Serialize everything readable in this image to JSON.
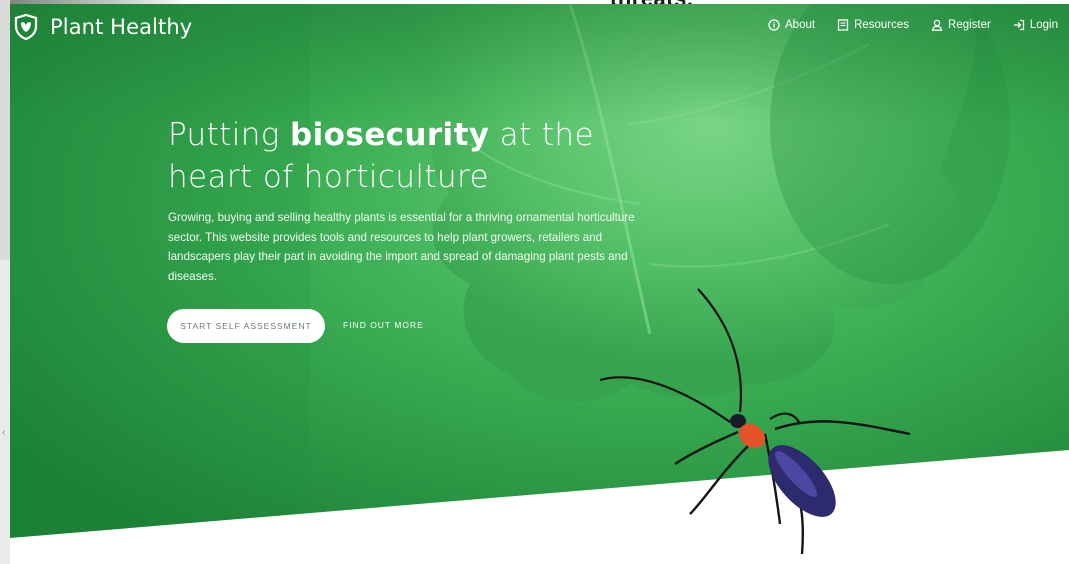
{
  "background_leak": {
    "top_text": "threats."
  },
  "brand": {
    "name": "Plant Healthy"
  },
  "nav": {
    "items": [
      {
        "label": "About",
        "icon": "info-icon"
      },
      {
        "label": "Resources",
        "icon": "book-icon"
      },
      {
        "label": "Register",
        "icon": "user-icon"
      },
      {
        "label": "Login",
        "icon": "login-icon"
      }
    ]
  },
  "hero": {
    "headline_pre": "Putting ",
    "headline_strong": "biosecurity",
    "headline_post": " at the",
    "headline_line2": "heart of horticulture",
    "lede": "Growing, buying and selling healthy plants is essential for a thriving ornamental horticulture sector. This website provides tools and resources to help plant growers, retailers and landscapers play their part in avoiding the import and spread of damaging plant pests and diseases.",
    "primary_cta": "START SELF ASSESSMENT",
    "secondary_cta": "FIND OUT MORE"
  },
  "colors": {
    "hero_green": "#2f9e4a",
    "hero_green_light": "#5ec66c",
    "hero_green_dark": "#1f7a35",
    "button_text": "#6b7a6e"
  }
}
